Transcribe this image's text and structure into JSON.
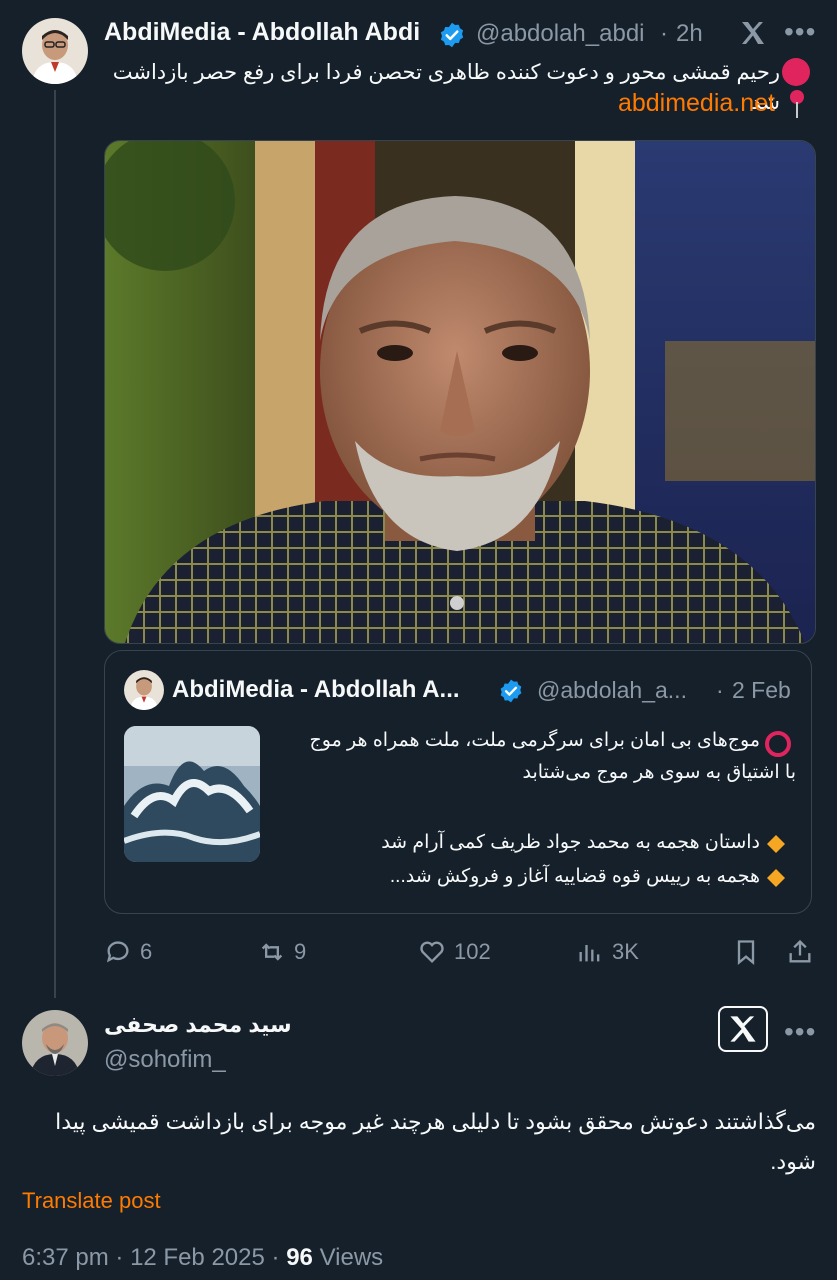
{
  "post": {
    "author_name": "AbdiMedia - Abdollah Abdi",
    "handle": "@abdolah_abdi",
    "time": "2h",
    "text": "رحیم قمشی محور و دعوت کننده ظاهری تحصن فردا برای رفع حصر بازداشت شد",
    "link": "abdimedia.net",
    "stats": {
      "replies": "6",
      "reposts": "9",
      "likes": "102",
      "views": "3K"
    }
  },
  "quote": {
    "author_name": "AbdiMedia - Abdollah A...",
    "handle": "@abdolah_a...",
    "date": "2 Feb",
    "line1": "موج‌های بی امان برای سرگرمی ملت، ملت همراه هر موج",
    "line2": "با اشتیاق به سوی هر موج می‌شتابد",
    "bullet1": "داستان هجمه به محمد جواد ظریف کمی آرام شد",
    "bullet2": "هجمه به رییس قوه قضاییه آغاز و فروکش شد..."
  },
  "reply": {
    "author_name": "سید محمد صحفی",
    "handle": "@sohofim_",
    "text": "می‌گذاشتند دعوتش محقق بشود تا  دلیلی هرچند غیر موجه برای بازداشت قمیشی  پیدا شود.",
    "translate_label": "Translate post",
    "time": "6:37 pm",
    "date": "12 Feb 2025",
    "views_count": "96",
    "views_label": "Views"
  },
  "icons": {
    "more": "more-icon",
    "x_logo": "x-logo-icon",
    "pin": "red-pin-icon"
  },
  "colors": {
    "background": "#15202b",
    "accent_link": "#ff7a00",
    "verified": "#1d9bf0",
    "muted": "#8b98a5"
  }
}
